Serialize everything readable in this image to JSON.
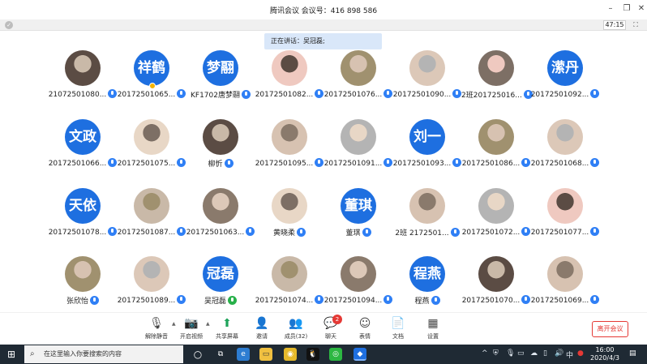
{
  "window": {
    "title": "腾讯会议 会议号：416 898 586",
    "timer": "47:15"
  },
  "speaking": {
    "label": "正在讲话：吴冠磊;"
  },
  "participants": [
    {
      "name": "21072501080...",
      "avatar_text": "",
      "mic": "blue"
    },
    {
      "name": "20172501065...",
      "avatar_text": "祥鹤",
      "mic": "blue",
      "host": true
    },
    {
      "name": "KF1702唐梦翮",
      "avatar_text": "梦翮",
      "mic": "blue"
    },
    {
      "name": "20172501082...",
      "avatar_text": "",
      "mic": "blue"
    },
    {
      "name": "20172501076...",
      "avatar_text": "",
      "mic": "blue"
    },
    {
      "name": "20172501090...",
      "avatar_text": "",
      "mic": "blue"
    },
    {
      "name": "2班201725016...",
      "avatar_text": "",
      "mic": "blue"
    },
    {
      "name": "20172501092...",
      "avatar_text": "潆丹",
      "mic": "blue"
    },
    {
      "name": "20172501066...",
      "avatar_text": "文政",
      "mic": "blue"
    },
    {
      "name": "20172501075...",
      "avatar_text": "",
      "mic": "blue"
    },
    {
      "name": "柳忻",
      "avatar_text": "",
      "mic": "blue"
    },
    {
      "name": "20172501095...",
      "avatar_text": "",
      "mic": "blue"
    },
    {
      "name": "20172501091...",
      "avatar_text": "",
      "mic": "blue"
    },
    {
      "name": "20172501093...",
      "avatar_text": "刘一",
      "mic": "blue"
    },
    {
      "name": "20172501086...",
      "avatar_text": "",
      "mic": "blue"
    },
    {
      "name": "20172501068...",
      "avatar_text": "",
      "mic": "blue"
    },
    {
      "name": "20172501078...",
      "avatar_text": "天依",
      "mic": "blue"
    },
    {
      "name": "20172501087...",
      "avatar_text": "",
      "mic": "blue"
    },
    {
      "name": "20172501063...",
      "avatar_text": "",
      "mic": "blue"
    },
    {
      "name": "黄晓柔",
      "avatar_text": "",
      "mic": "blue"
    },
    {
      "name": "董琪",
      "avatar_text": "董琪",
      "mic": "blue"
    },
    {
      "name": "2班 2172501...",
      "avatar_text": "",
      "mic": "blue"
    },
    {
      "name": "20172501072...",
      "avatar_text": "",
      "mic": "blue"
    },
    {
      "name": "20172501077...",
      "avatar_text": "",
      "mic": "blue"
    },
    {
      "name": "张欣怡",
      "avatar_text": "",
      "mic": "blue"
    },
    {
      "name": "20172501089...",
      "avatar_text": "",
      "mic": "blue"
    },
    {
      "name": "吴冠磊",
      "avatar_text": "冠磊",
      "mic": "green"
    },
    {
      "name": "20172501074...",
      "avatar_text": "",
      "mic": "blue"
    },
    {
      "name": "20172501094...",
      "avatar_text": "",
      "mic": "blue"
    },
    {
      "name": "程燕",
      "avatar_text": "程燕",
      "mic": "blue"
    },
    {
      "name": "20172501070...",
      "avatar_text": "",
      "mic": "blue"
    },
    {
      "name": "20172501069...",
      "avatar_text": "",
      "mic": "blue"
    }
  ],
  "toolbar": {
    "mute": "解除静音",
    "video": "开启视频",
    "share": "共享屏幕",
    "invite": "邀请",
    "members": "成员(32)",
    "chat": "聊天",
    "chat_badge": "2",
    "reactions": "表情",
    "docs": "文档",
    "settings": "设置",
    "leave": "离开会议"
  },
  "taskbar": {
    "search_placeholder": "在这里输入你要搜索的内容",
    "time": "16:00",
    "date": "2020/4/3"
  },
  "colors": {
    "accent": "#1e6fe0",
    "danger": "#e53935",
    "taskbar": "#1f2a34"
  }
}
